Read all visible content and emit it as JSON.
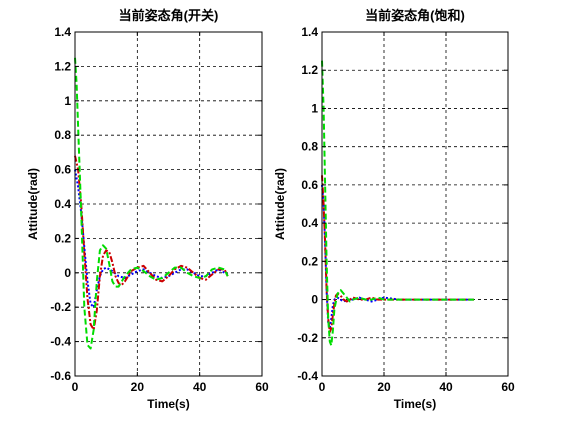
{
  "chart_data": [
    {
      "type": "line",
      "title": "当前姿态角(开关)",
      "xlabel": "Time(s)",
      "ylabel": "Attitude(rad)",
      "xlim": [
        0,
        60
      ],
      "ylim": [
        -0.6,
        1.4
      ],
      "xticks": [
        0,
        20,
        40,
        60
      ],
      "yticks": [
        -0.6,
        -0.4,
        -0.2,
        0,
        0.2,
        0.4,
        0.6,
        0.8,
        1,
        1.2,
        1.4
      ],
      "grid": true,
      "series": [
        {
          "style": "dotted",
          "color": "#0000ff",
          "x": [
            0,
            1,
            2,
            3,
            4,
            5,
            6,
            7,
            8,
            9,
            10,
            12,
            14,
            16,
            18,
            20,
            22,
            24,
            26,
            28,
            30,
            32,
            34,
            36,
            38,
            40,
            42,
            44,
            46,
            48,
            49
          ],
          "values": [
            0.6,
            0.5,
            0.35,
            0.15,
            -0.05,
            -0.18,
            -0.2,
            -0.1,
            -0.02,
            0.02,
            0.03,
            0.01,
            -0.02,
            -0.03,
            -0.01,
            0.01,
            0.02,
            0.0,
            -0.02,
            -0.03,
            -0.02,
            0.0,
            0.02,
            0.02,
            0.0,
            -0.02,
            -0.02,
            0.0,
            0.02,
            0.0,
            -0.01
          ]
        },
        {
          "style": "dashdot",
          "color": "#cc0000",
          "x": [
            0,
            1,
            2,
            3,
            4,
            5,
            6,
            7,
            8,
            9,
            10,
            11,
            12,
            13,
            14,
            15,
            16,
            18,
            20,
            22,
            24,
            26,
            28,
            30,
            32,
            34,
            36,
            38,
            40,
            42,
            44,
            46,
            48,
            49
          ],
          "values": [
            0.68,
            0.6,
            0.4,
            0.12,
            -0.15,
            -0.3,
            -0.33,
            -0.22,
            -0.02,
            0.1,
            0.13,
            0.12,
            0.06,
            -0.02,
            -0.06,
            -0.07,
            -0.05,
            0.01,
            0.03,
            0.04,
            0.0,
            -0.04,
            -0.05,
            -0.02,
            0.02,
            0.04,
            0.03,
            0.0,
            -0.03,
            -0.04,
            -0.01,
            0.02,
            0.02,
            -0.02
          ]
        },
        {
          "style": "dashed",
          "color": "#00dd00",
          "x": [
            0,
            0.5,
            1,
            2,
            3,
            4,
            5,
            6,
            7,
            8,
            9,
            10,
            11,
            12,
            13,
            14,
            15,
            16,
            18,
            20,
            22,
            24,
            26,
            28,
            30,
            32,
            34,
            36,
            38,
            40,
            42,
            44,
            46,
            48,
            49
          ],
          "values": [
            1.25,
            1.1,
            0.85,
            0.35,
            -0.2,
            -0.42,
            -0.44,
            -0.33,
            -0.05,
            0.13,
            0.16,
            0.14,
            0.05,
            -0.05,
            -0.08,
            -0.08,
            -0.05,
            -0.02,
            0.02,
            0.03,
            0.01,
            -0.02,
            -0.04,
            -0.03,
            0.0,
            0.03,
            0.03,
            0.0,
            -0.02,
            -0.03,
            -0.02,
            0.02,
            0.03,
            0.02,
            -0.02
          ]
        }
      ]
    },
    {
      "type": "line",
      "title": "当前姿态角(饱和)",
      "xlabel": "Time(s)",
      "ylabel": "Attitude(rad)",
      "xlim": [
        0,
        60
      ],
      "ylim": [
        -0.4,
        1.4
      ],
      "xticks": [
        0,
        20,
        40,
        60
      ],
      "yticks": [
        -0.4,
        -0.2,
        0,
        0.2,
        0.4,
        0.6,
        0.8,
        1,
        1.2,
        1.4
      ],
      "grid": true,
      "series": [
        {
          "style": "dotted",
          "color": "#0000ff",
          "x": [
            0,
            0.5,
            1,
            1.5,
            2,
            2.5,
            3,
            3.5,
            4,
            5,
            6,
            7,
            8,
            10,
            12,
            14,
            16,
            18,
            20,
            25,
            30,
            35,
            40,
            45,
            48,
            49
          ],
          "values": [
            0.6,
            0.5,
            0.3,
            0.05,
            -0.12,
            -0.15,
            -0.1,
            -0.03,
            0.0,
            0.01,
            0.0,
            -0.01,
            0.0,
            0.0,
            0.01,
            0.0,
            -0.01,
            0.0,
            0.01,
            0.0,
            0.0,
            0.0,
            0.0,
            0.0,
            0.0,
            0.0
          ]
        },
        {
          "style": "dashdot",
          "color": "#cc0000",
          "x": [
            0,
            0.5,
            1,
            1.5,
            2,
            2.5,
            3,
            3.5,
            4,
            4.5,
            5,
            6,
            7,
            8,
            9,
            10,
            12,
            14,
            16,
            18,
            20,
            25,
            30,
            35,
            40,
            45,
            48,
            49
          ],
          "values": [
            0.65,
            0.5,
            0.3,
            0.05,
            -0.1,
            -0.17,
            -0.15,
            -0.08,
            -0.02,
            0.02,
            0.03,
            0.02,
            0.0,
            -0.01,
            0.0,
            0.01,
            0.0,
            0.0,
            0.01,
            0.0,
            0.0,
            0.0,
            0.0,
            0.0,
            0.0,
            0.0,
            0.0,
            0.0
          ]
        },
        {
          "style": "dashed",
          "color": "#00dd00",
          "x": [
            0,
            0.5,
            1,
            1.5,
            2,
            2.5,
            3,
            3.5,
            4,
            5,
            6,
            7,
            8,
            9,
            10,
            12,
            14,
            16,
            18,
            20,
            25,
            30,
            35,
            40,
            45,
            48,
            49
          ],
          "values": [
            1.25,
            1.0,
            0.6,
            0.2,
            -0.1,
            -0.22,
            -0.24,
            -0.16,
            -0.05,
            0.03,
            0.05,
            0.03,
            0.01,
            -0.01,
            0.0,
            0.01,
            0.0,
            0.0,
            0.01,
            0.0,
            0.0,
            0.0,
            0.0,
            0.0,
            0.0,
            0.0,
            0.0
          ]
        }
      ]
    }
  ]
}
